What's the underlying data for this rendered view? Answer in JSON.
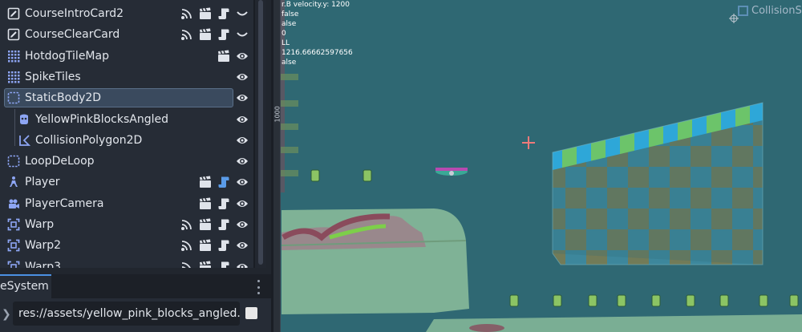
{
  "scene_tree": {
    "nodes": [
      {
        "label": "CourseIntroCard2",
        "icon": "sprite-edit-icon",
        "actions": [
          "signal-icon",
          "scene-icon",
          "script-icon",
          "collapse-icon"
        ]
      },
      {
        "label": "CourseClearCard",
        "icon": "sprite-edit-icon",
        "actions": [
          "signal-icon",
          "scene-icon",
          "script-icon",
          "collapse-icon"
        ]
      },
      {
        "label": "HotdogTileMap",
        "icon": "tilemap-icon",
        "actions": [
          "scene-icon",
          "visibility-icon"
        ]
      },
      {
        "label": "SpikeTiles",
        "icon": "tilemap-icon",
        "actions": [
          "visibility-icon"
        ]
      },
      {
        "label": "StaticBody2D",
        "icon": "staticbody-icon",
        "actions": [
          "visibility-icon"
        ],
        "selected": true
      },
      {
        "label": "YellowPinkBlocksAngled",
        "icon": "sprite-icon",
        "actions": [
          "visibility-icon"
        ],
        "child": true
      },
      {
        "label": "CollisionPolygon2D",
        "icon": "collision-polygon-icon",
        "actions": [
          "visibility-icon"
        ],
        "child": true
      },
      {
        "label": "LoopDeLoop",
        "icon": "staticbody-icon",
        "actions": [
          "visibility-icon"
        ]
      },
      {
        "label": "Player",
        "icon": "player-icon",
        "actions": [
          "scene-icon",
          "script-icon",
          "visibility-icon"
        ]
      },
      {
        "label": "PlayerCamera",
        "icon": "camera-icon",
        "actions": [
          "scene-icon",
          "script-icon",
          "visibility-icon"
        ]
      },
      {
        "label": "Warp",
        "icon": "area-icon",
        "actions": [
          "signal-icon",
          "scene-icon",
          "script-icon",
          "visibility-icon"
        ]
      },
      {
        "label": "Warp2",
        "icon": "area-icon",
        "actions": [
          "signal-icon",
          "scene-icon",
          "script-icon",
          "visibility-icon"
        ]
      },
      {
        "label": "Warp3",
        "icon": "area-icon",
        "actions": [
          "signal-icon",
          "scene-icon",
          "script-icon",
          "visibility-icon"
        ]
      }
    ]
  },
  "filesystem": {
    "tab_label": "eSystem",
    "path": "res://assets/yellow_pink_blocks_angled.png"
  },
  "viewport": {
    "ruler_label": "1000",
    "debug_lines": [
      "r.B velocity.y: 1200",
      "false",
      "alse",
      "0",
      "LL",
      "1216.66662597656",
      "alse"
    ],
    "collision_label": "CollisionS"
  },
  "colors": {
    "accent": "#4b90e2",
    "viewport_bg": "#2f6873",
    "selected_row": "#3a4a5e"
  }
}
